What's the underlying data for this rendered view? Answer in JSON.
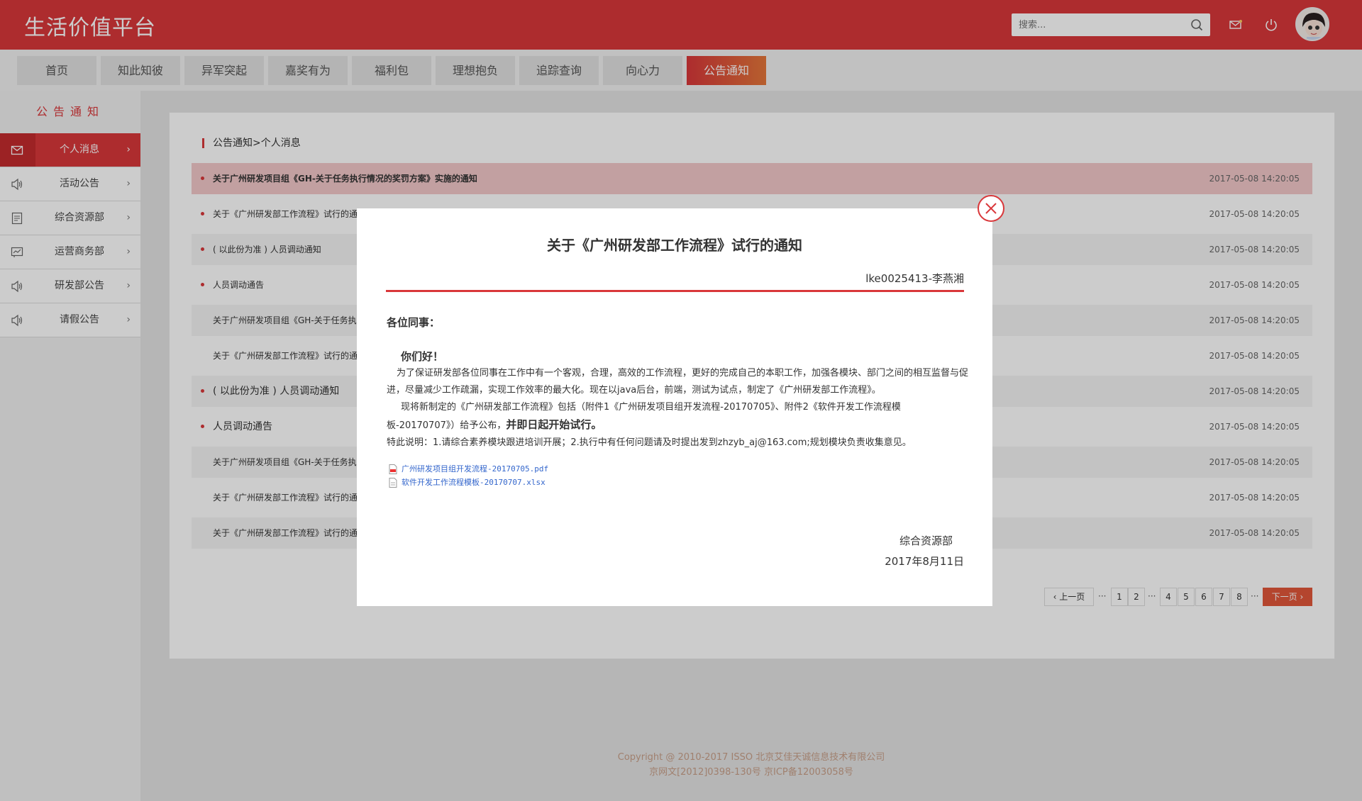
{
  "header": {
    "logo": "生活价值平台",
    "search_placeholder": "搜索..."
  },
  "nav": {
    "tabs": [
      "首页",
      "知此知彼",
      "异军突起",
      "嘉奖有为",
      "福利包",
      "理想抱负",
      "追踪查询",
      "向心力",
      "公告通知"
    ],
    "active": "公告通知"
  },
  "sidebar": {
    "title": "公告通知",
    "items": [
      {
        "label": "个人消息",
        "icon": "mail-icon"
      },
      {
        "label": "活动公告",
        "icon": "speaker-icon"
      },
      {
        "label": "综合资源部",
        "icon": "document-icon"
      },
      {
        "label": "运营商务部",
        "icon": "chat-icon"
      },
      {
        "label": "研发部公告",
        "icon": "speaker-icon"
      },
      {
        "label": "请假公告",
        "icon": "speaker-icon"
      }
    ]
  },
  "breadcrumb": "公告通知>个人消息",
  "list": [
    {
      "title": "关于广州研发项目组《GH-关于任务执行情况的奖罚方案》实施的通知",
      "date": "2017-05-08    14:20:05"
    },
    {
      "title": "关于《广州研发部工作流程》试行的通",
      "date": "2017-05-08    14:20:05"
    },
    {
      "title": "( 以此份为准 ) 人员调动通知",
      "date": "2017-05-08    14:20:05"
    },
    {
      "title": "人员调动通告",
      "date": "2017-05-08    14:20:05"
    },
    {
      "title": "关于广州研发项目组《GH-关于任务执",
      "date": "2017-05-08    14:20:05"
    },
    {
      "title": "关于《广州研发部工作流程》试行的通",
      "date": "2017-05-08    14:20:05"
    },
    {
      "title": "( 以此份为准 ) 人员调动通知",
      "date": "2017-05-08    14:20:05"
    },
    {
      "title": "人员调动通告",
      "date": "2017-05-08    14:20:05"
    },
    {
      "title": "关于广州研发项目组《GH-关于任务执",
      "date": "2017-05-08    14:20:05"
    },
    {
      "title": "关于《广州研发部工作流程》试行的通",
      "date": "2017-05-08    14:20:05"
    },
    {
      "title": "关于《广州研发部工作流程》试行的通",
      "date": "2017-05-08    14:20:05"
    }
  ],
  "pager": {
    "prev": "上一页",
    "next": "下一页",
    "dots": "···",
    "pages": [
      "1",
      "2",
      "4",
      "5",
      "6",
      "7",
      "8"
    ]
  },
  "footer": {
    "line1": "Copyright @ 2010-2017 ISSO 北京艾佳天诚信息技术有限公司",
    "line2": "京网文[2012]0398-130号        京ICP备12003058号"
  },
  "modal": {
    "title": "关于《广州研发部工作流程》试行的通知",
    "author": "lke0025413-李燕湘",
    "greeting": "各位同事：",
    "hello": "你们好！",
    "para1": "为了保证研发部各位同事在工作中有一个客观，合理，高效的工作流程，更好的完成自己的本职工作，加强各模块、部门之间的相互监督与促进，尽量减少工作疏漏，实现工作效率的最大化。现在以java后台，前端，测试为试点，制定了《广州研发部工作流程》。",
    "para2": "现将新制定的《广州研发部工作流程》包括（附件1《广州研发项目组开发流程-20170705》、附件2《软件开发工作流程模板-20170707》）给予公布，",
    "para2_bold": "并即日起开始试行。",
    "para3": "特此说明：1.请综合素养模块跟进培训开展；2.执行中有任何问题请及时提出发到zhzyb_aj@163.com;规划模块负责收集意见。",
    "files": [
      "广州研发项目组开发流程-20170705.pdf",
      "软件开发工作流程模板-20170707.xlsx"
    ],
    "dept": "综合资源部",
    "date": "2017年8月11日"
  }
}
